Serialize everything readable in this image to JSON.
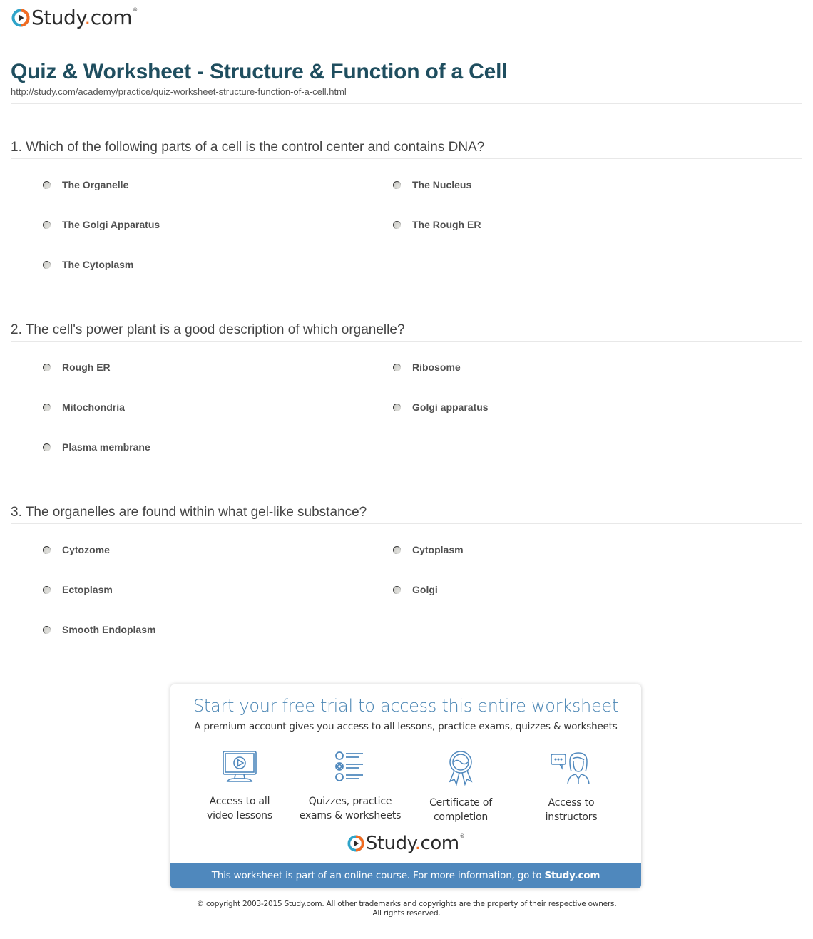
{
  "brand": {
    "name_main": "Study",
    "name_dot": ".",
    "name_tld": "com",
    "reg_mark": "®",
    "logo_icon": "play-circle-icon",
    "accent_color": "#f26b21",
    "ring_color": "#2fa4c9"
  },
  "header": {
    "title": "Quiz & Worksheet - Structure & Function of a Cell",
    "url": "http://study.com/academy/practice/quiz-worksheet-structure-function-of-a-cell.html"
  },
  "questions": [
    {
      "text": "1. Which of the following parts of a cell is the control center and contains DNA?",
      "answers": [
        "The Organelle",
        "The Nucleus",
        "The Golgi Apparatus",
        "The Rough ER",
        "The Cytoplasm"
      ]
    },
    {
      "text": "2. The cell's power plant is a good description of which organelle?",
      "answers": [
        "Rough ER",
        "Ribosome",
        "Mitochondria",
        "Golgi apparatus",
        "Plasma membrane"
      ]
    },
    {
      "text": "3. The organelles are found within what gel-like substance?",
      "answers": [
        "Cytozome",
        "Cytoplasm",
        "Ectoplasm",
        "Golgi",
        "Smooth Endoplasm"
      ]
    }
  ],
  "promo": {
    "title": "Start your free trial to access this entire worksheet",
    "subtitle": "A premium account gives you access to all lessons, practice exams, quizzes & worksheets",
    "features": [
      {
        "icon": "video-monitor-icon",
        "line1": "Access to all",
        "line2": "video lessons"
      },
      {
        "icon": "quiz-list-icon",
        "line1": "Quizzes, practice",
        "line2": "exams & worksheets"
      },
      {
        "icon": "certificate-ribbon-icon",
        "line1": "Certificate of",
        "line2": "completion"
      },
      {
        "icon": "instructor-chat-icon",
        "line1": "Access to",
        "line2": "instructors"
      }
    ],
    "bar_text": "This worksheet is part of an online course. For more information, go to ",
    "bar_link": "Study.com",
    "icon_color": "#4f88bd",
    "bar_color": "#4f88bd"
  },
  "footer": {
    "copyright_line1": "© copyright 2003-2015 Study.com. All other trademarks and copyrights are the property of their respective owners.",
    "copyright_line2": "All rights reserved."
  }
}
